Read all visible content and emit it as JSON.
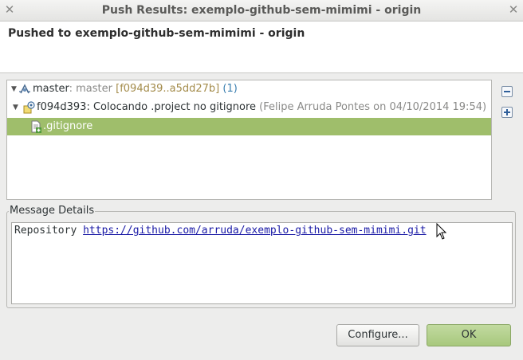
{
  "window": {
    "title": "Push Results: exemplo-github-sem-mimimi - origin"
  },
  "header": {
    "message": "Pushed to exemplo-github-sem-mimimi - origin"
  },
  "tree": {
    "branch": {
      "name": "master",
      "sep": ": ",
      "remote": "master ",
      "range": "[f094d39..a5dd27b]",
      "count": " (1)"
    },
    "commit": {
      "id_message": "f094d393: Colocando .project no gitignore",
      "meta": " (Felipe Arruda Pontes on 04/10/2014 19:54)"
    },
    "file": {
      "name": ".gitignore"
    }
  },
  "details": {
    "group_label": "Message Details",
    "prefix": "Repository ",
    "url": "https://github.com/arruda/exemplo-github-sem-mimimi.git"
  },
  "buttons": {
    "configure": "Configure...",
    "ok": "OK"
  }
}
